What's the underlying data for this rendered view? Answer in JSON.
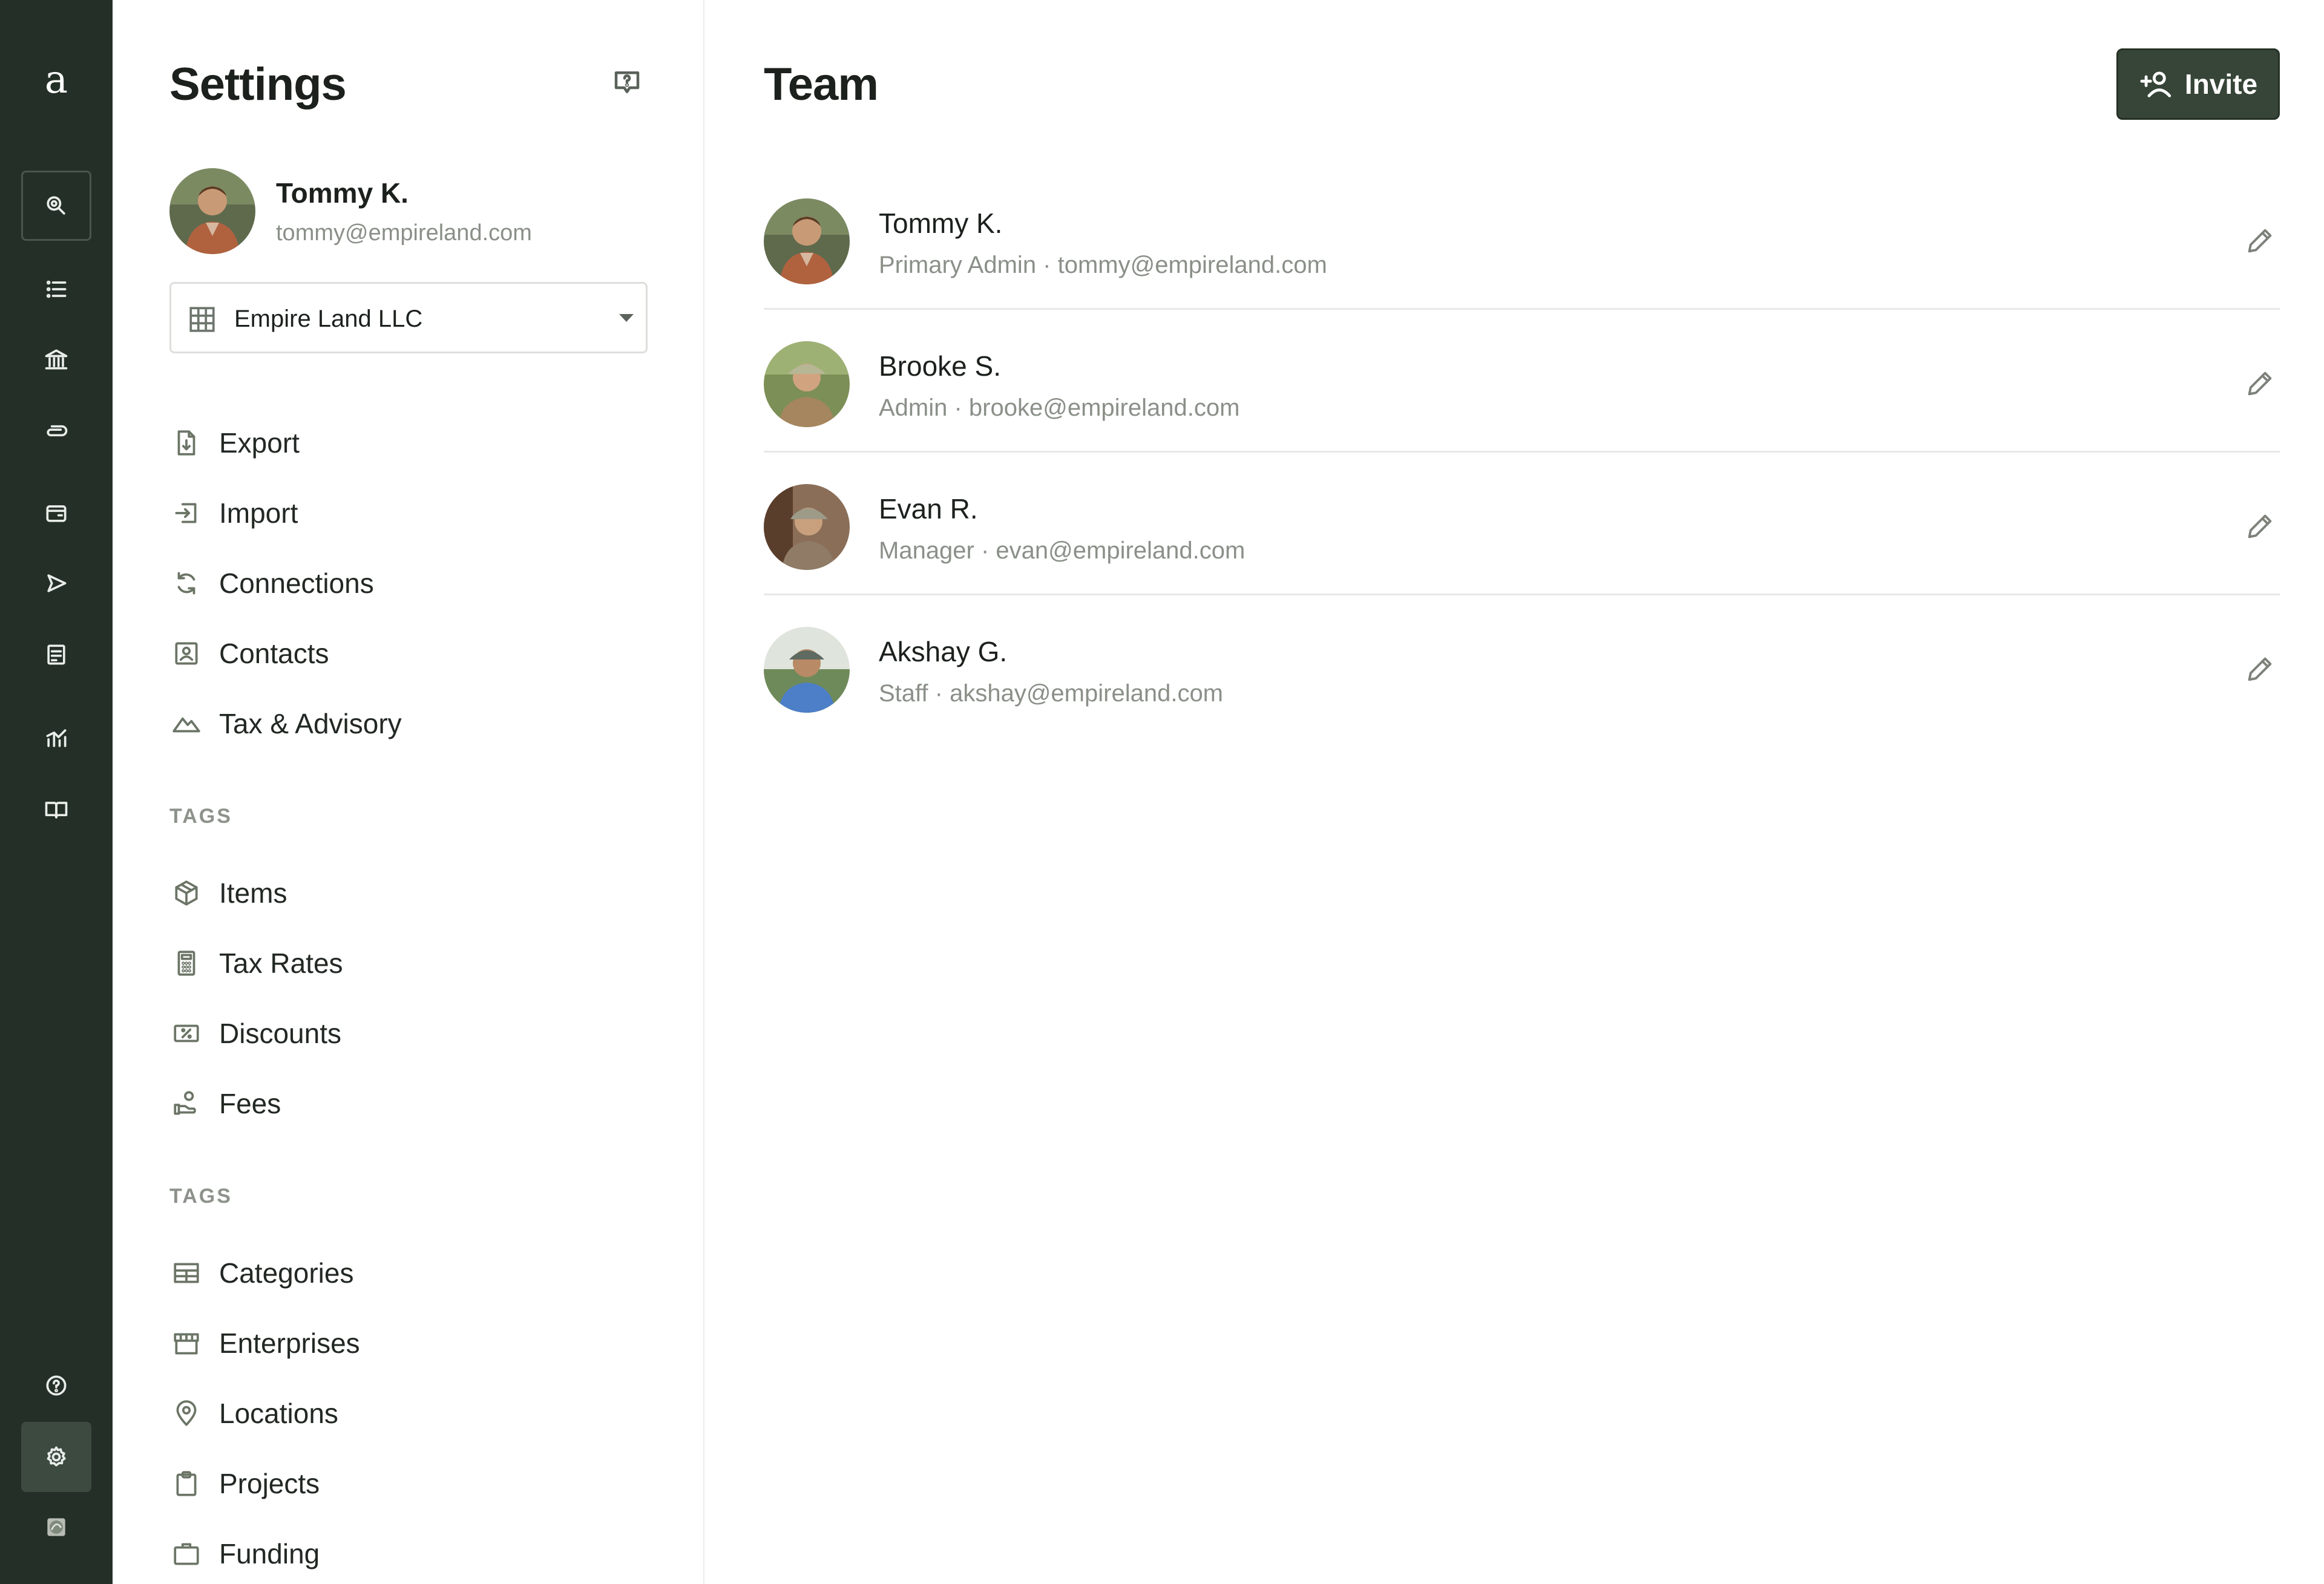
{
  "app": {
    "logo_letter": "a"
  },
  "rail": {
    "items": [
      {
        "icon": "search-icon"
      },
      {
        "icon": "list-icon"
      },
      {
        "icon": "bank-icon"
      },
      {
        "icon": "paperclip-icon"
      },
      {
        "icon": "wallet-icon"
      },
      {
        "icon": "send-icon"
      },
      {
        "icon": "receipt-icon"
      },
      {
        "icon": "chart-icon"
      },
      {
        "icon": "book-icon"
      },
      {
        "icon": "help-circle-icon"
      },
      {
        "icon": "gear-icon"
      },
      {
        "icon": "org-avatar-icon"
      }
    ]
  },
  "settings": {
    "title": "Settings",
    "profile": {
      "name": "Tommy K.",
      "email": "tommy@empireland.com"
    },
    "org_select": {
      "value": "Empire Land LLC"
    },
    "menu": [
      {
        "label": "Export",
        "icon": "export-file-icon"
      },
      {
        "label": "Import",
        "icon": "import-icon"
      },
      {
        "label": "Connections",
        "icon": "sync-icon"
      },
      {
        "label": "Contacts",
        "icon": "contact-card-icon"
      },
      {
        "label": "Tax & Advisory",
        "icon": "mountain-icon"
      }
    ],
    "section1_label": "TAGS",
    "tags1": [
      {
        "label": "Items",
        "icon": "package-icon"
      },
      {
        "label": "Tax Rates",
        "icon": "calculator-icon"
      },
      {
        "label": "Discounts",
        "icon": "discount-ticket-icon"
      },
      {
        "label": "Fees",
        "icon": "hand-coin-icon"
      }
    ],
    "section2_label": "TAGS",
    "tags2": [
      {
        "label": "Categories",
        "icon": "table-icon"
      },
      {
        "label": "Enterprises",
        "icon": "storefront-icon"
      },
      {
        "label": "Locations",
        "icon": "map-pin-icon"
      },
      {
        "label": "Projects",
        "icon": "clipboard-icon"
      },
      {
        "label": "Funding",
        "icon": "briefcase-icon"
      }
    ]
  },
  "team": {
    "title": "Team",
    "invite_label": "Invite",
    "members": [
      {
        "name": "Tommy K.",
        "role": "Primary Admin",
        "email": "tommy@empireland.com",
        "sub": "Primary Admin · tommy@empireland.com"
      },
      {
        "name": "Brooke S.",
        "role": "Admin",
        "email": "brooke@empireland.com",
        "sub": "Admin · brooke@empireland.com"
      },
      {
        "name": "Evan R.",
        "role": "Manager",
        "email": "evan@empireland.com",
        "sub": "Manager · evan@empireland.com"
      },
      {
        "name": "Akshay G.",
        "role": "Staff",
        "email": "akshay@empireland.com",
        "sub": "Staff · akshay@empireland.com"
      }
    ]
  },
  "colors": {
    "rail_bg": "#243027",
    "accent": "#364537",
    "muted_text": "#8a9088"
  }
}
